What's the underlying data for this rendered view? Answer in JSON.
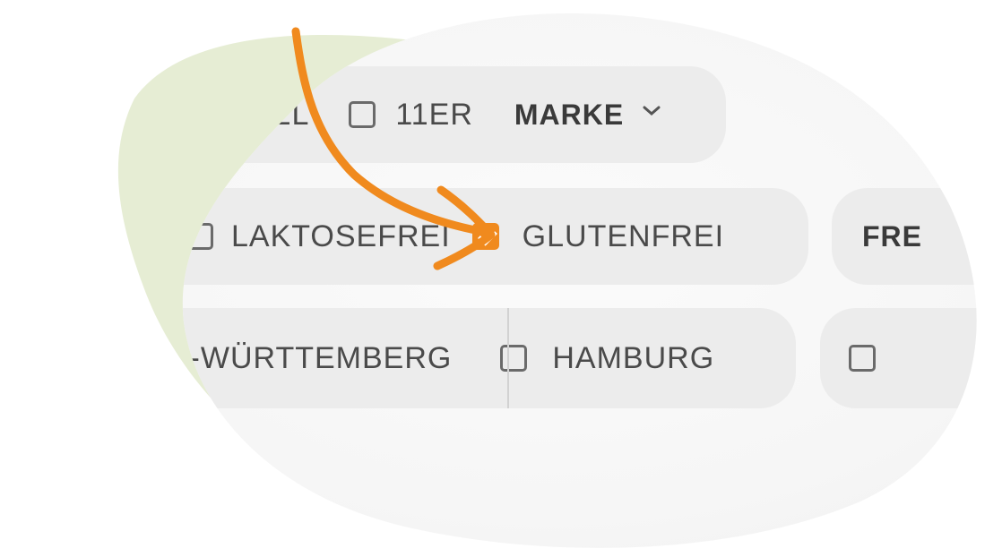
{
  "colors": {
    "accent": "#f08a1e",
    "green_blob": "#e6edd4",
    "pill_bg": "#ececec"
  },
  "row1": {
    "partial_label": "ZEL",
    "option_11er": {
      "label": "11ER",
      "checked": false
    },
    "dropdown": {
      "label": "MARKE",
      "icon": "chevron-down-icon"
    }
  },
  "row2": {
    "option_laktosefrei": {
      "label": "LAKTOSEFREI",
      "checked": false
    },
    "option_glutenfrei": {
      "label": "GLUTENFREI",
      "checked": true
    },
    "partial_label": "FRE"
  },
  "row3": {
    "option_bw": {
      "label": "N-WÜRTTEMBERG"
    },
    "option_hamburg": {
      "label": "HAMBURG",
      "checked": false
    }
  },
  "annotation": {
    "icon": "arrow-icon"
  }
}
